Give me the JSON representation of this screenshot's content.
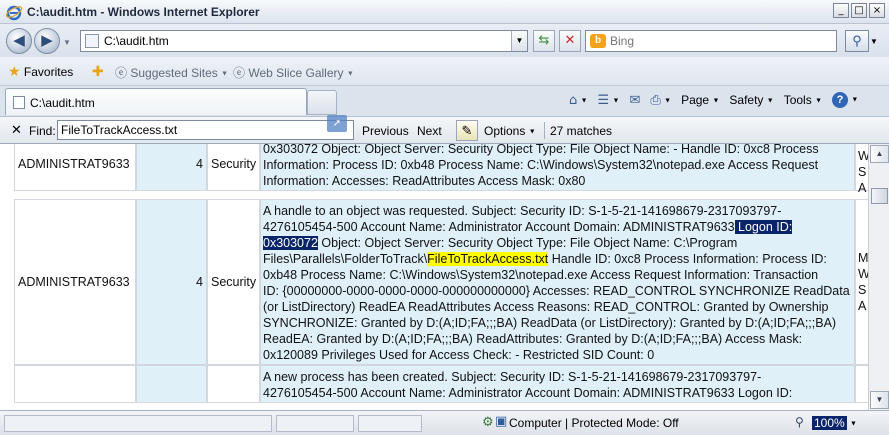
{
  "window": {
    "title": "C:\\audit.htm - Windows Internet Explorer",
    "controls": [
      "_",
      "□",
      "×"
    ]
  },
  "address_bar": {
    "url": "C:\\audit.htm"
  },
  "search": {
    "placeholder": "Bing"
  },
  "favorites_bar": {
    "favorites_label": "Favorites",
    "suggested_sites": "Suggested Sites",
    "web_slice_gallery": "Web Slice Gallery"
  },
  "tab": {
    "label": "C:\\audit.htm"
  },
  "command_bar": {
    "page": "Page",
    "safety": "Safety",
    "tools": "Tools"
  },
  "find_bar": {
    "label": "Find:",
    "query": "FileToTrackAccess.txt",
    "previous": "Previous",
    "next": "Next",
    "options": "Options",
    "matches": "27 matches"
  },
  "rows": [
    {
      "user": "ADMINISTRAT9633",
      "num": "4",
      "source": "Security",
      "lines": [
        [
          {
            "t": "0x303072 Object: Object Server: Security Object Type: File Object Name: - Handle ID: 0xc8 Process"
          }
        ],
        [
          {
            "t": "Information: Process ID: 0xb48 Process Name: C:\\Windows\\System32\\notepad.exe Access Request"
          }
        ],
        [
          {
            "t": "Information: Accesses: ReadAttributes Access Mask: 0x80"
          }
        ]
      ],
      "extra": [
        "S",
        "W",
        "S",
        "A"
      ]
    },
    {
      "user": "ADMINISTRAT9633",
      "num": "4",
      "source": "Security",
      "lines": [
        [
          {
            "t": "A handle to an object was requested. Subject: Security ID: S-1-5-21-141698679-2317093797-"
          }
        ],
        [
          {
            "t": "4276105454-500 Account Name: Administrator Account Domain: ADMINISTRAT9633"
          },
          {
            "t": " Logon ID:",
            "s": "sel"
          }
        ],
        [
          {
            "t": "0x303072",
            "s": "sel"
          },
          {
            "t": " Object: Object Server: Security Object Type: File Object Name: C:\\Program"
          }
        ],
        [
          {
            "t": "Files\\Parallels\\FolderToTrack\\"
          },
          {
            "t": "FileToTrackAccess.txt",
            "s": "hit"
          },
          {
            "t": " Handle ID: 0xc8 Process Information: Process ID:"
          }
        ],
        [
          {
            "t": "0xb48 Process Name: C:\\Windows\\System32\\notepad.exe Access Request Information: Transaction"
          }
        ],
        [
          {
            "t": "ID: {00000000-0000-0000-0000-000000000000} Accesses: READ_CONTROL SYNCHRONIZE ReadData"
          }
        ],
        [
          {
            "t": "(or ListDirectory) ReadEA ReadAttributes Access Reasons: READ_CONTROL: Granted by Ownership"
          }
        ],
        [
          {
            "t": "SYNCHRONIZE: Granted by D:(A;ID;FA;;;BA) ReadData (or ListDirectory): Granted by D:(A;ID;FA;;;BA)"
          }
        ],
        [
          {
            "t": "ReadEA: Granted by D:(A;ID;FA;;;BA) ReadAttributes: Granted by D:(A;ID;FA;;;BA) Access Mask:"
          }
        ],
        [
          {
            "t": "0x120089 Privileges Used for Access Check: - Restricted SID Count: 0"
          }
        ]
      ],
      "extra": [
        "M",
        "W",
        "S",
        "A"
      ]
    },
    {
      "user": "",
      "num": "",
      "source": "",
      "lines": [
        [
          {
            "t": "A new process has been created. Subject: Security ID: S-1-5-21-141698679-2317093797-"
          }
        ],
        [
          {
            "t": "4276105454-500 Account Name: Administrator Account Domain: ADMINISTRAT9633 Logon ID:"
          }
        ]
      ],
      "extra": []
    }
  ],
  "status_bar": {
    "zone": "Computer | Protected Mode: Off",
    "zoom": "100%"
  }
}
